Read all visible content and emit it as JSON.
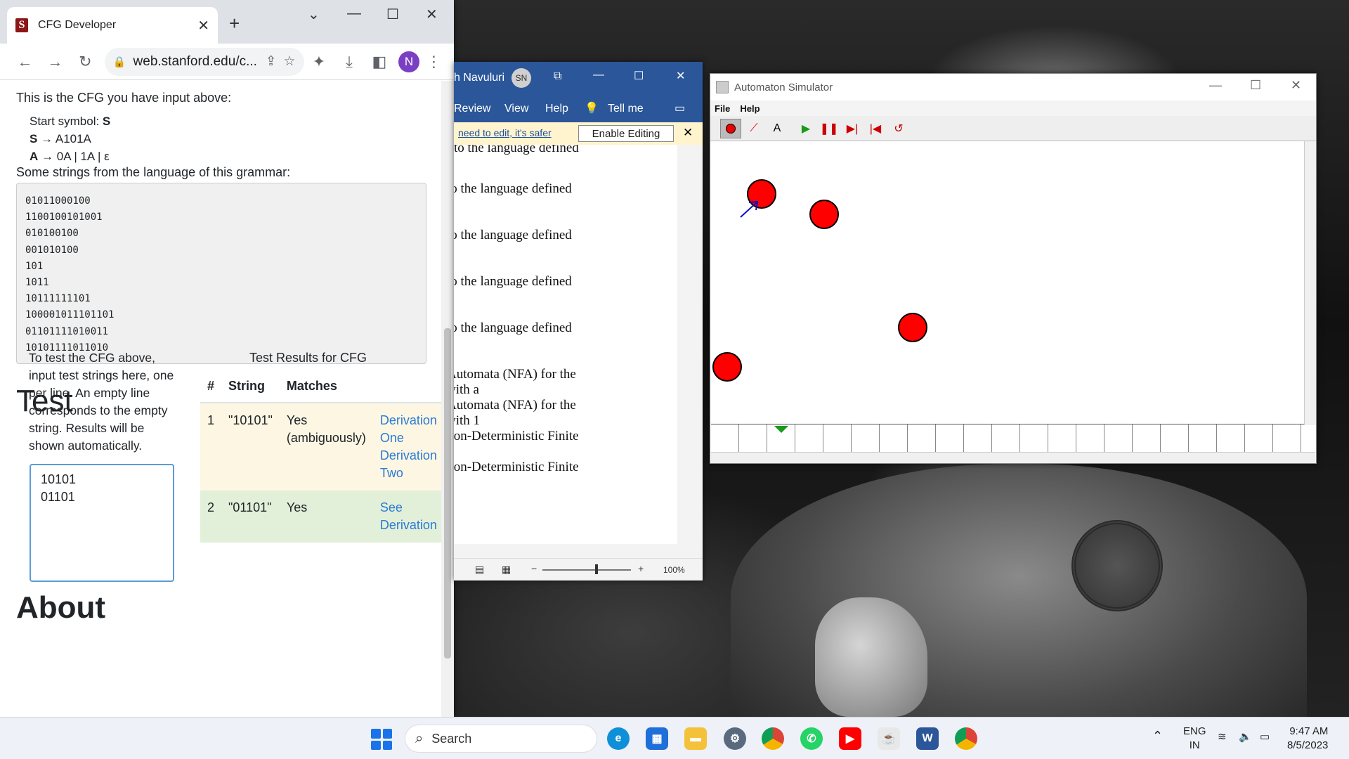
{
  "chrome": {
    "tab_title": "CFG Developer",
    "url": "web.stanford.edu/c...",
    "profile_initial": "N",
    "cfg_intro": "This is the CFG you have input above:",
    "start_symbol_label": "Start symbol: ",
    "start_symbol": "S",
    "rule1_lhs": "S",
    "rule1_rhs": "A101A",
    "rule2_lhs": "A",
    "rule2_rhs": "0A | 1A | ε",
    "strings_intro": "Some strings from the language of this grammar:",
    "strings": [
      "01011000100",
      "1100100101001",
      "010100100",
      "001010100",
      "101",
      "1011",
      "10111111101",
      "100001011101101",
      "01101111010011",
      "10101111011010"
    ],
    "test_heading": "Test",
    "test_description": "To test the CFG above, input test strings here, one per line. An empty line corresponds to the empty string. Results will be shown automatically.",
    "test_input": "10101\n01101",
    "results_caption": "Test Results for CFG",
    "results_headers": [
      "#",
      "String",
      "Matches"
    ],
    "results": [
      {
        "num": "1",
        "string": "\"10101\"",
        "matches": "Yes (ambiguously)",
        "link1": "Derivation One",
        "link2": "Derivation Two"
      },
      {
        "num": "2",
        "string": "\"01101\"",
        "matches": "Yes",
        "link1": "See Derivation",
        "link2": ""
      }
    ],
    "about_heading": "About"
  },
  "word": {
    "user_name": "h Navuluri",
    "user_initials": "SN",
    "ribbon_tabs": [
      "Review",
      "View",
      "Help"
    ],
    "tell_me": "Tell me",
    "protected_msg": "need to edit, it's safer",
    "enable_editing": "Enable Editing",
    "doc_lines": [
      "to the language defined",
      "to the language defined",
      "to the language defined",
      "to the language defined",
      "to the language defined",
      "Automata (NFA) for the",
      "with a",
      "Automata (NFA) for the",
      "with 1",
      "Non-Deterministic Finite",
      "Non-Deterministic Finite"
    ],
    "zoom": "100%"
  },
  "automaton": {
    "title": "Automaton Simulator",
    "menu": [
      "File",
      "Help"
    ]
  },
  "taskbar": {
    "search_placeholder": "Search",
    "lang": "ENG",
    "region": "IN",
    "time": "9:47 AM",
    "date": "8/5/2023"
  },
  "colors": {
    "word_blue": "#2b579a",
    "state_red": "#ff0000",
    "link_blue": "#2a7bd5",
    "stanford_red": "#8c1515"
  }
}
